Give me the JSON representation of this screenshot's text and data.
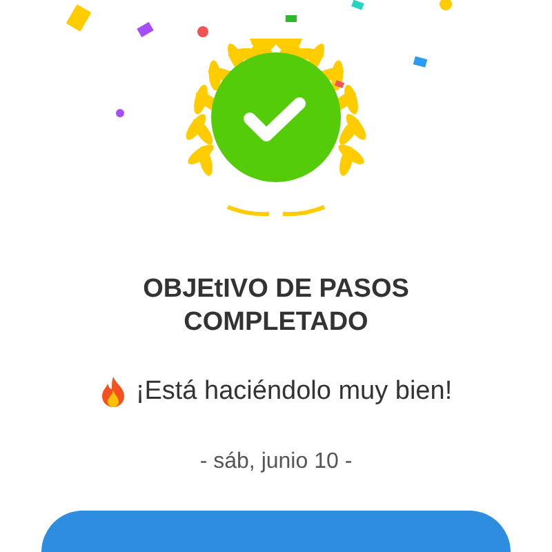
{
  "title": "OBJEtIVO DE PASOS COMPLETADO",
  "message": "¡Está haciéndolo muy bien!",
  "date": "- sáb, junio 10 -"
}
